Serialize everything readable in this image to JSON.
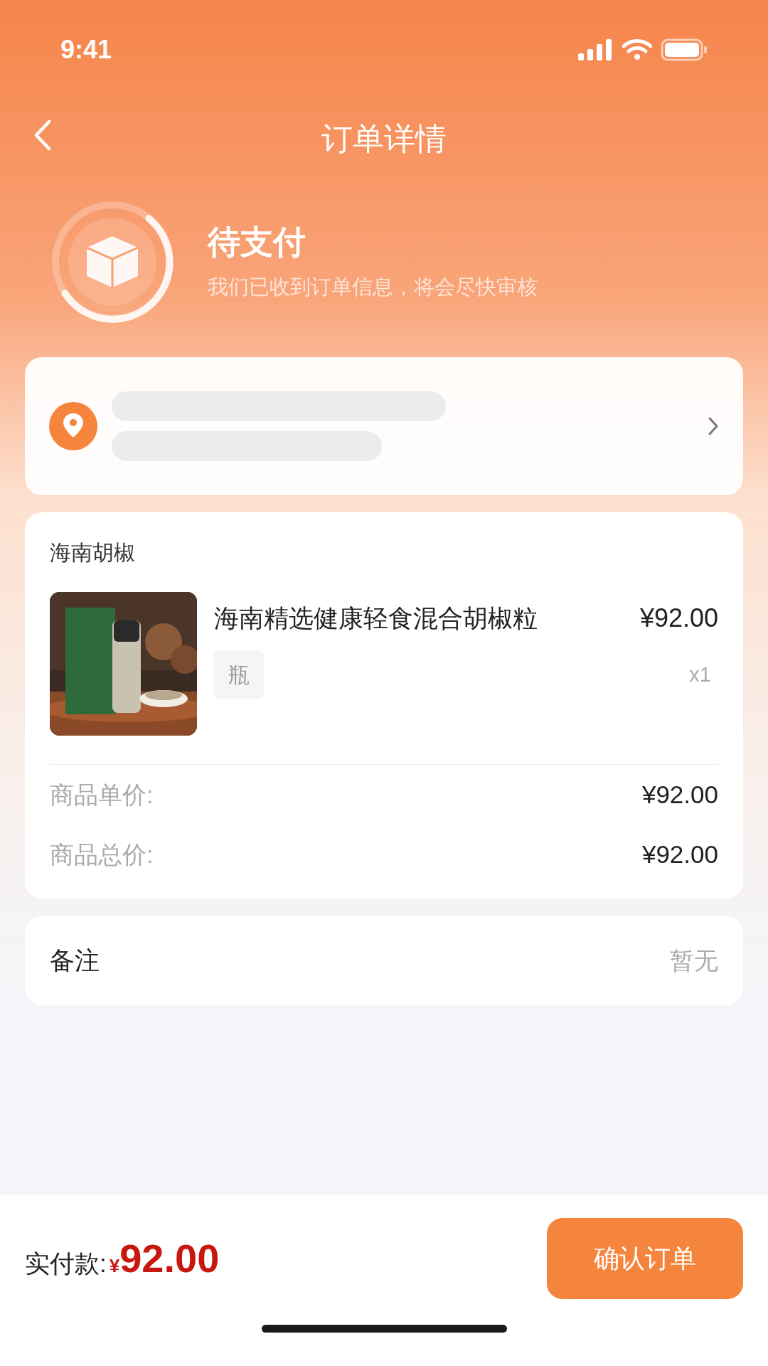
{
  "status_bar": {
    "time": "9:41"
  },
  "nav": {
    "title": "订单详情"
  },
  "order_status": {
    "title": "待支付",
    "message": "我们已收到订单信息，将会尽快审核"
  },
  "address": {
    "redacted": true
  },
  "shop": {
    "name": "海南胡椒"
  },
  "items": [
    {
      "name": "海南精选健康轻食混合胡椒粒",
      "price": "¥92.00",
      "spec": "瓶",
      "quantity": "x1"
    }
  ],
  "summary": [
    {
      "label": "商品单价:",
      "value": "¥92.00"
    },
    {
      "label": "商品总价:",
      "value": "¥92.00"
    }
  ],
  "remark": {
    "label": "备注",
    "value": "暂无"
  },
  "footer": {
    "label": "实付款:",
    "currency": "¥",
    "amount": "92.00",
    "button": "确认订单"
  }
}
